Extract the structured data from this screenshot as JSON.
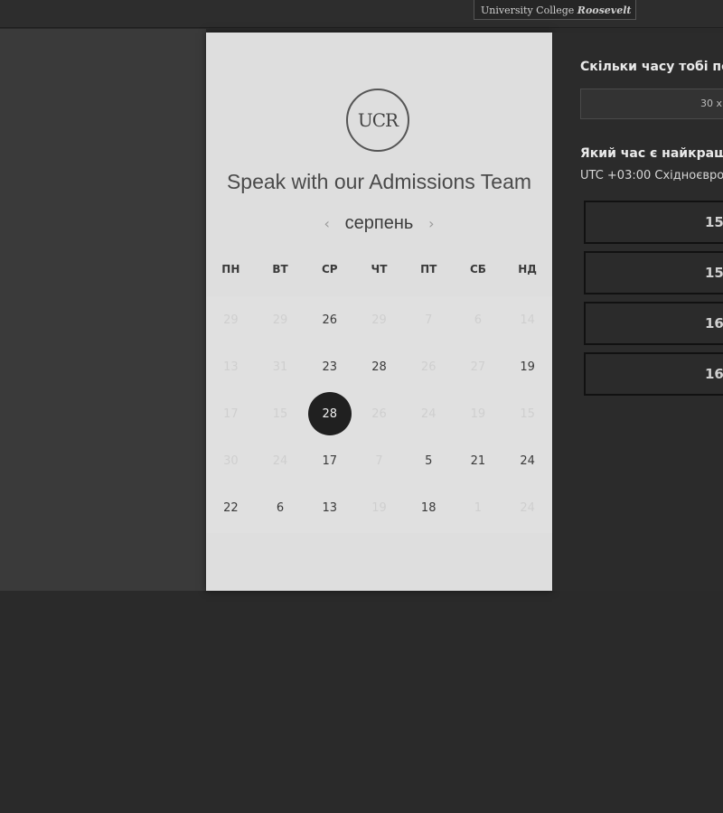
{
  "header": {
    "logo_text": "University College",
    "logo_accent": "Roosevelt"
  },
  "card": {
    "logo_text": "UCR",
    "title": "Speak with our Admissions Team",
    "month": "серпень",
    "prev_icon": "‹",
    "next_icon": "›",
    "weekdays": [
      "ПН",
      "ВТ",
      "СР",
      "ЧТ",
      "ПТ",
      "СБ",
      "НД"
    ],
    "days": [
      "29",
      "29",
      "26",
      "29",
      "7",
      "6",
      "14",
      "13",
      "31",
      "23",
      "28",
      "26",
      "27",
      "19",
      "17",
      "15",
      "28",
      "26",
      "24",
      "19",
      "15",
      "30",
      "24",
      "17",
      "7",
      "5",
      "21",
      "24",
      "22",
      "6",
      "13",
      "19",
      "18",
      "1",
      "24"
    ],
    "selected_day": "28"
  },
  "right": {
    "duration_question": "Скільки часу тобі пот",
    "duration_value": "30 хв",
    "time_question": "Який час є найкращи",
    "timezone": "UTC +03:00 Східноєвро",
    "slots": [
      "15:",
      "15:",
      "16:",
      "16:"
    ]
  }
}
